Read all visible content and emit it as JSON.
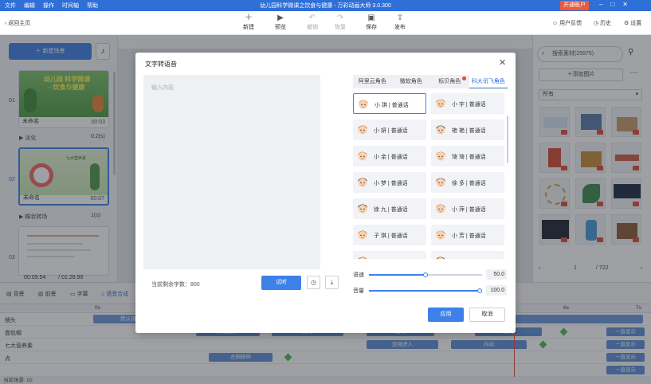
{
  "titlebar": {
    "menu": [
      "文件",
      "编辑",
      "操作",
      "时间轴",
      "帮助"
    ],
    "app_title": "幼儿园科学微课之饮食与健康 - 万彩动画大师 3.0.300",
    "vip": "开通账户"
  },
  "toolbar": {
    "back": "返回主页",
    "buttons": [
      {
        "label": "新建",
        "icon": "plus-icon"
      },
      {
        "label": "预览",
        "icon": "play-icon"
      },
      {
        "label": "撤销",
        "icon": "undo-icon",
        "disabled": true
      },
      {
        "label": "恢复",
        "icon": "redo-icon",
        "disabled": true
      },
      {
        "label": "保存",
        "icon": "save-icon"
      },
      {
        "label": "发布",
        "icon": "publish-icon"
      }
    ],
    "feedback": "用户反馈",
    "history": "历史",
    "settings": "设置"
  },
  "scenes": {
    "new_scene": "新建场景",
    "items": [
      {
        "num": "01",
        "name": "未命名",
        "time": "00:03",
        "transition": "淡化",
        "trans_time": "0.2(s)",
        "thumb_title": "幼儿园 科学微课 - 饮食与健康"
      },
      {
        "num": "02",
        "name": "未命名",
        "time": "00:07",
        "transition": "蝶状转场",
        "trans_time": "1(s)",
        "thumb_title": "七大营养素"
      },
      {
        "num": "03",
        "name": "",
        "time": "",
        "transition": "",
        "trans_time": ""
      }
    ]
  },
  "right_panel": {
    "search_placeholder": "搜索素材(25975)",
    "add_image": "添加图片",
    "filter": "所有",
    "side_tabs": [
      "图片",
      "角色",
      "文本",
      "音乐",
      "特效",
      "素材",
      "组件",
      "形状",
      "更多"
    ],
    "pager": {
      "current": "1",
      "total": "/ 722"
    }
  },
  "dialog": {
    "title": "文字转语音",
    "placeholder": "输入内容",
    "counter_label": "当前剩余字数：",
    "counter_value": "800",
    "try_label": "试听",
    "tabs": [
      "阿里云角色",
      "微软角色",
      "标贝角色",
      "科大讯飞角色"
    ],
    "active_tab": 3,
    "voices": [
      {
        "name": "小 琪 | 普通话",
        "color": "#e8a07a",
        "selected": true
      },
      {
        "name": "小 宇 | 普通话",
        "color": "#d9a070"
      },
      {
        "name": "小 妍 | 普通话",
        "color": "#c98a60"
      },
      {
        "name": "艳 艳 | 普通话",
        "color": "#6a5a50"
      },
      {
        "name": "小 余 | 普通话",
        "color": "#e09a70"
      },
      {
        "name": "琦 琦 | 普通话",
        "color": "#e8a070"
      },
      {
        "name": "小 梦 | 普通话",
        "color": "#7a5a48"
      },
      {
        "name": "徐 多 | 普通话",
        "color": "#8a6a58"
      },
      {
        "name": "徐 九 | 普通话",
        "color": "#5a4a40"
      },
      {
        "name": "小 萍 | 普通话",
        "color": "#d89070"
      },
      {
        "name": "子 琪 | 普通话",
        "color": "#e08a60"
      },
      {
        "name": "小 芳 | 普通话",
        "color": "#e0a878"
      },
      {
        "name": "小 蓉 | 普通话",
        "color": "#b87a58"
      },
      {
        "name": "小 美 | 普通话",
        "color": "#7a5a48"
      }
    ],
    "speed_label": "语速",
    "speed_value": "50.0",
    "speed_fraction": 0.5,
    "volume_label": "音量",
    "volume_value": "100.0",
    "volume_fraction": 1.0,
    "apply": "应用",
    "cancel": "取消"
  },
  "timeline": {
    "current_time": "00:09.54",
    "total_time": "/ 01:26.96",
    "tabs": [
      "背景",
      "前景",
      "字幕",
      "语音合成"
    ],
    "active_tab": 3,
    "ruler": {
      "start": "0s",
      "mark_6": "6s",
      "mark_7": "7s"
    },
    "rows": [
      {
        "label": "镜头",
        "clips": [
          {
            "text": "默认镜头"
          }
        ],
        "end": ""
      },
      {
        "label": "面包帽",
        "clips": [
          {
            "text": "弹跳进入"
          },
          {
            "text": "摇均"
          },
          {
            "text": "摇均"
          },
          {
            "text": "摇均"
          }
        ],
        "end": "一直显示"
      },
      {
        "label": "七大营养素",
        "clips": [
          {
            "text": "加强进入"
          },
          {
            "text": "抖动"
          }
        ],
        "end": "一直显示"
      },
      {
        "label": "点",
        "clips": [
          {
            "text": "左侧移伸"
          }
        ],
        "end": "一直显示"
      },
      {
        "label": "",
        "clips": [],
        "end": "一直显示"
      }
    ],
    "status": "当前场景: 02"
  }
}
